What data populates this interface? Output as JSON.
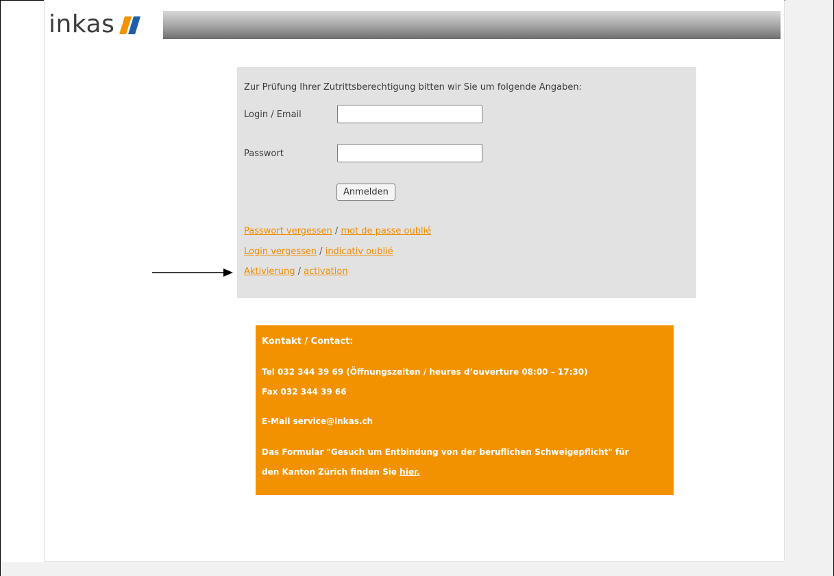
{
  "header": {
    "logo_text": "inkas",
    "accent_blue": "#1f5fa8",
    "accent_orange": "#f39200"
  },
  "login": {
    "intro": "Zur Prüfung Ihrer Zutrittsberechtigung bitten wir Sie um folgende Angaben:",
    "login_label": "Login / Email",
    "login_value": "",
    "password_label": "Passwort",
    "password_value": "",
    "submit_label": "Anmelden",
    "links": [
      {
        "de": "Passwort vergessen",
        "sep": " / ",
        "fr": "mot de passe oublié"
      },
      {
        "de": "Login vergessen",
        "sep": " / ",
        "fr": "indicativ oublié"
      },
      {
        "de": "Aktivierung",
        "sep": " / ",
        "fr": "activation"
      }
    ]
  },
  "contact": {
    "title": "Kontakt / Contact:",
    "tel": "Tel 032 344 39 69 (Öffnungszeiten / heures d’ouverture 08:00 – 17:30)",
    "fax": "Fax 032 344 39 66",
    "email": "E-Mail service@inkas.ch",
    "form_line1": "Das Formular \"Gesuch um Entbindung von der beruflichen Schweigepflicht\" für",
    "form_line2_prefix": "den Kanton Zürich finden Sie ",
    "form_link": "hier."
  }
}
